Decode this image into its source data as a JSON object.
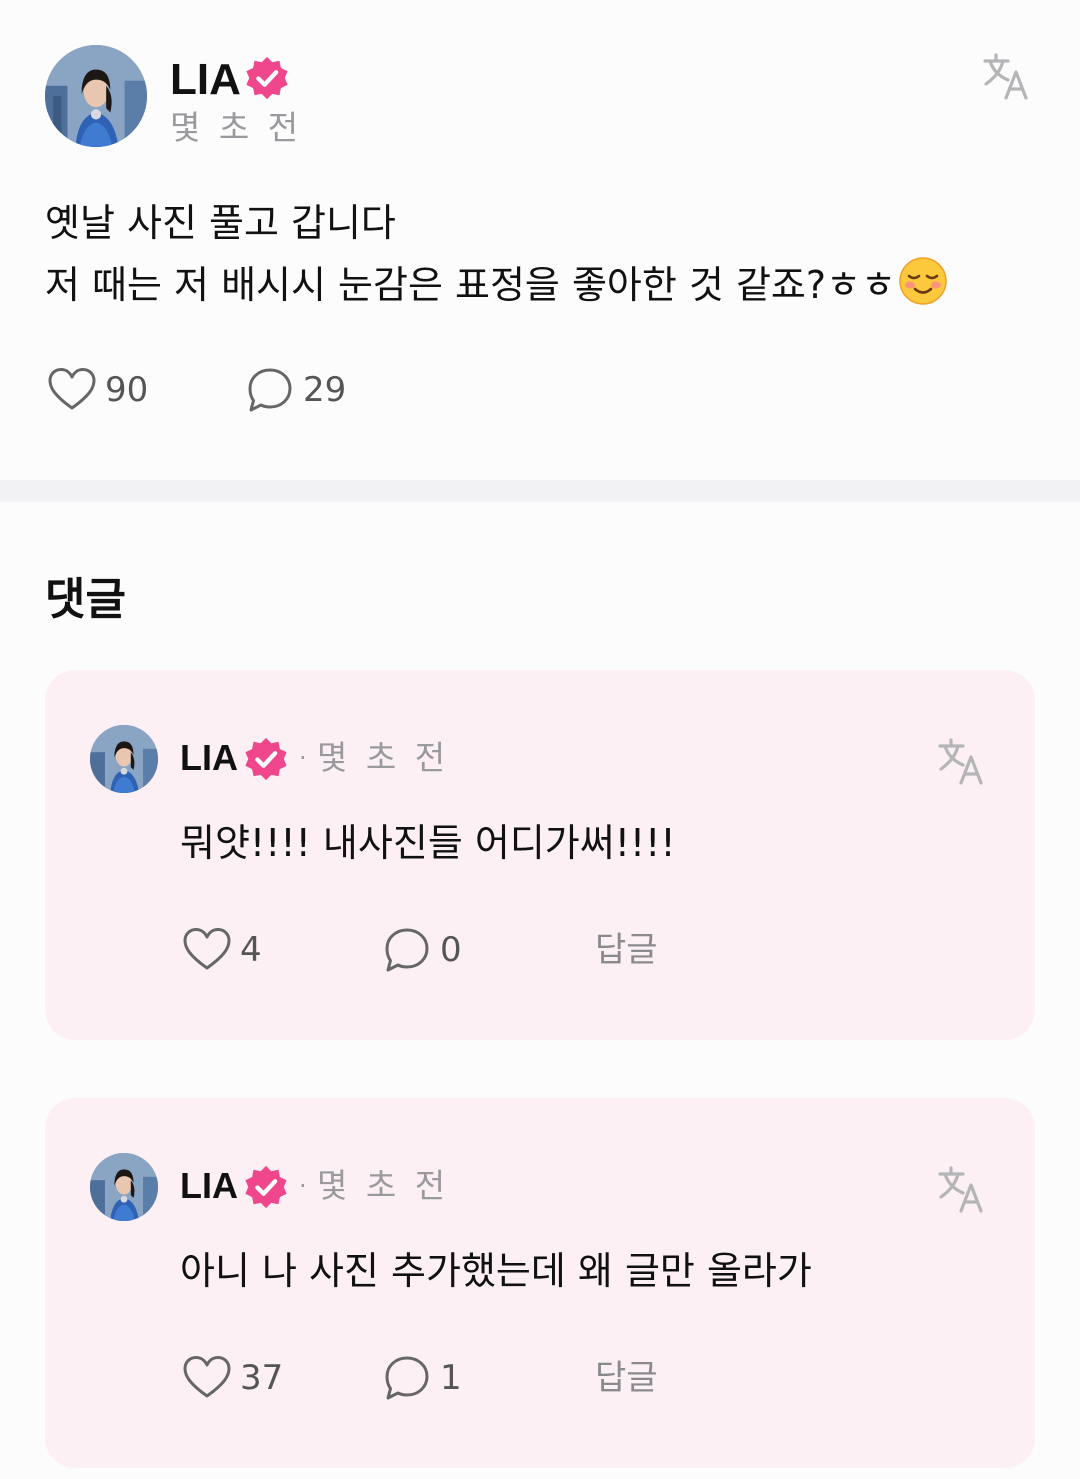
{
  "post": {
    "author": "LIA",
    "time": "몇 초 전",
    "body_lines": [
      "옛날 사진 풀고 갑니다",
      "저 때는 저 배시시 눈감은 표정을 좋아한 것 같죠?ㅎㅎ"
    ],
    "emoji": "smiling-face-emoji",
    "likes": "90",
    "comments": "29",
    "icons": {
      "avatar": "avatar",
      "badge": "verified-badge-icon",
      "translate": "translate-icon",
      "like": "heart-icon",
      "comment": "comment-bubble-icon"
    }
  },
  "comments_section": {
    "title": "댓글",
    "items": [
      {
        "author": "LIA",
        "separator": "·",
        "time": "몇 초 전",
        "text": "뭐얏!!!! 내사진들 어디가써!!!!",
        "likes": "4",
        "replies": "0",
        "reply_label": "답글"
      },
      {
        "author": "LIA",
        "separator": "·",
        "time": "몇 초 전",
        "text": "아니 나 사진 추가했는데 왜 글만 올라가",
        "likes": "37",
        "replies": "1",
        "reply_label": "답글"
      }
    ]
  },
  "colors": {
    "badge": "#f0468c",
    "card_background": "#fdf0f4",
    "secondary_text": "#9a9a9e"
  }
}
